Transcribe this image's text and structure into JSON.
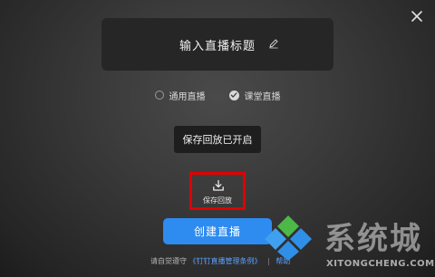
{
  "title_input": {
    "value": "输入直播标题"
  },
  "mode": {
    "options": [
      {
        "label": "通用直播",
        "checked": false
      },
      {
        "label": "课堂直播",
        "checked": true
      }
    ]
  },
  "replay_status": "保存回放已开启",
  "save_replay": {
    "label": "保存回放"
  },
  "create_button": {
    "label": "创建直播"
  },
  "agreement": {
    "prefix": "请自觉遵守",
    "link": "《钉钉直播管理条例》",
    "separator": "|",
    "help": "帮助"
  },
  "watermark": {
    "characters": "系统城",
    "domain": "XITONGCHENG.COM"
  },
  "colors": {
    "primary": "#2e8bf0",
    "highlight_border": "#e00000",
    "link": "#5aa0ff"
  },
  "icons": [
    "close-icon",
    "edit-icon",
    "check-icon",
    "download-icon"
  ]
}
